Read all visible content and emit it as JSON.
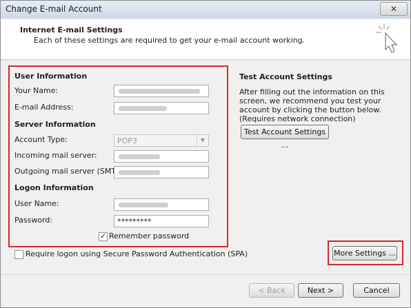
{
  "window": {
    "title": "Change E-mail Account",
    "close_symbol": "✕"
  },
  "header": {
    "title": "Internet E-mail Settings",
    "subtitle": "Each of these settings are required to get your e-mail account working."
  },
  "user_info": {
    "section_title": "User Information",
    "name_label": "Your Name:",
    "email_label": "E-mail Address:"
  },
  "server_info": {
    "section_title": "Server Information",
    "account_type_label": "Account Type:",
    "account_type_value": "POP3",
    "incoming_label": "Incoming mail server:",
    "outgoing_label": "Outgoing mail server (SMTP):"
  },
  "logon_info": {
    "section_title": "Logon Information",
    "username_label": "User Name:",
    "password_label": "Password:",
    "password_value": "*********",
    "remember_label": "Remember password",
    "remember_checked": true
  },
  "spa": {
    "label": "Require logon using Secure Password Authentication (SPA)",
    "checked": false
  },
  "test": {
    "section_title": "Test Account Settings",
    "description": "After filling out the information on this screen, we recommend you test your account by clicking the button below. (Requires network connection)",
    "button_label": "Test Account Settings ..."
  },
  "buttons": {
    "more_settings": "More Settings ...",
    "back": "< Back",
    "next": "Next >",
    "cancel": "Cancel"
  },
  "colors": {
    "highlight": "#d8262b"
  }
}
